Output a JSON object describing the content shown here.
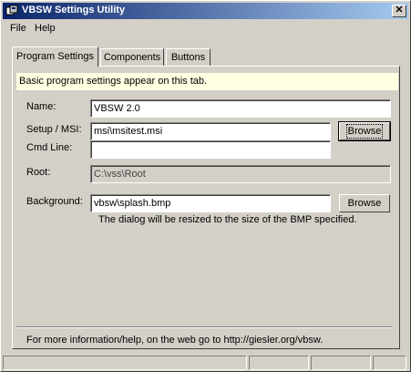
{
  "window": {
    "title": "VBSW Settings Utility",
    "close_label": "✕"
  },
  "menu": {
    "file": "File",
    "help": "Help"
  },
  "tabs": {
    "program_settings": "Program Settings",
    "components": "Components",
    "buttons": "Buttons"
  },
  "info": "Basic program settings appear on this tab.",
  "form": {
    "name_label": "Name:",
    "name_value": "VBSW 2.0",
    "setup_label": "Setup / MSI:",
    "setup_value": "msi\\msitest.msi",
    "setup_browse": "Browse",
    "cmdline_label": "Cmd Line:",
    "cmdline_value": "",
    "root_label": "Root:",
    "root_value": "C:\\vss\\Root",
    "background_label": "Background:",
    "background_value": "vbsw\\splash.bmp",
    "background_browse": "Browse",
    "background_note": "The dialog will be resized to the size of the BMP specified."
  },
  "footer": "For more information/help, on the web go to http://giesler.org/vbsw.",
  "colors": {
    "face": "#d4d0c8",
    "title_start": "#0a246a",
    "title_end": "#a6caf0",
    "info_bg": "#ffffe1"
  }
}
